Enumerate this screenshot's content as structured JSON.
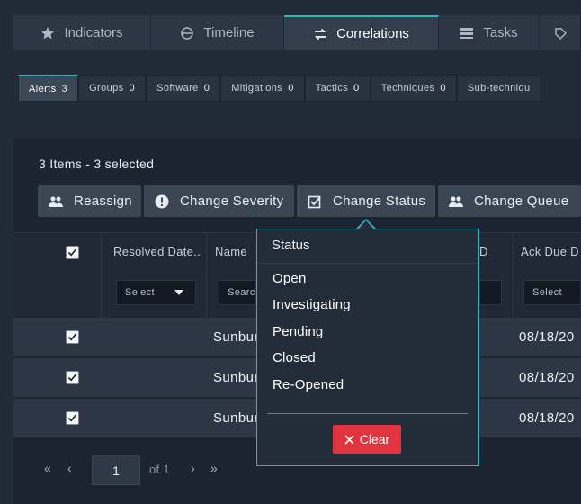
{
  "top_tabs": [
    {
      "label": "Indicators",
      "icon": "star-icon"
    },
    {
      "label": "Timeline",
      "icon": "timeline-icon"
    },
    {
      "label": "Correlations",
      "icon": "exchange-icon",
      "active": true
    },
    {
      "label": "Tasks",
      "icon": "tasks-icon"
    }
  ],
  "sub_tabs": [
    {
      "label": "Alerts",
      "count": "3",
      "active": true
    },
    {
      "label": "Groups",
      "count": "0"
    },
    {
      "label": "Software",
      "count": "0"
    },
    {
      "label": "Mitigations",
      "count": "0"
    },
    {
      "label": "Tactics",
      "count": "0"
    },
    {
      "label": "Techniques",
      "count": "0"
    },
    {
      "label": "Sub-techniqu",
      "count": ""
    }
  ],
  "selection_summary": "3 Items - 3 selected",
  "actions": {
    "reassign": "Reassign",
    "change_severity": "Change Severity",
    "change_status": "Change Status",
    "change_queue": "Change Queue"
  },
  "table": {
    "columns": {
      "resolved_date": "Resolved Date..",
      "name": "Name",
      "hidden_col_suffix": "D",
      "ack_due": "Ack Due D"
    },
    "filters": {
      "resolved_date_select": "Select",
      "name_search_placeholder": "Searc",
      "ack_due_select": "Select"
    },
    "rows": [
      {
        "name": "Sunbur",
        "ack_due": "08/18/20",
        "selected": true
      },
      {
        "name": "Sunbur",
        "ack_due": "08/18/20",
        "selected": true
      },
      {
        "name": "Sunbur",
        "ack_due": "08/18/20",
        "selected": true
      }
    ]
  },
  "pagination": {
    "page": "1",
    "of_text": "of 1"
  },
  "status_dropdown": {
    "title": "Status",
    "options": [
      "Open",
      "Investigating",
      "Pending",
      "Closed",
      "Re-Opened"
    ],
    "clear_label": "Clear"
  },
  "colors": {
    "accent": "#2fb6bf",
    "danger": "#e0353f",
    "background": "#212b38"
  }
}
